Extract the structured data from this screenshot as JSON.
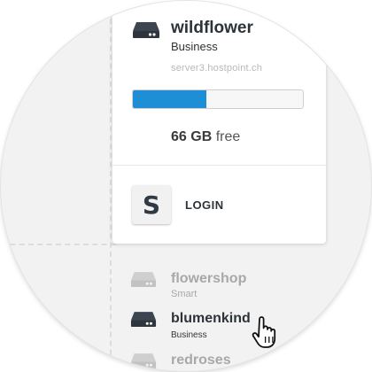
{
  "active_server": {
    "name": "wildflower",
    "plan": "Business",
    "host": "server3.hostpoint.ch",
    "storage_used_fraction": 0.43,
    "free_amount": "66 GB",
    "free_label": "free",
    "icon": "server-icon"
  },
  "login": {
    "tile_letter": "S",
    "label": "LOGIN",
    "icon": "s-logo-icon"
  },
  "server_list": [
    {
      "name": "flowershop",
      "plan": "Smart",
      "state": "inactive",
      "icon": "server-icon"
    },
    {
      "name": "blumenkind",
      "plan": "Business",
      "state": "hover",
      "icon": "server-icon"
    },
    {
      "name": "redroses",
      "plan": "",
      "state": "inactive",
      "icon": "server-icon"
    }
  ],
  "pointer": {
    "icon": "hand-pointer-icon"
  },
  "colors": {
    "accent": "#1e8fd6",
    "text_dark": "#2e3338",
    "text_muted": "#b9b9b9",
    "inactive": "#a8a8a8"
  }
}
